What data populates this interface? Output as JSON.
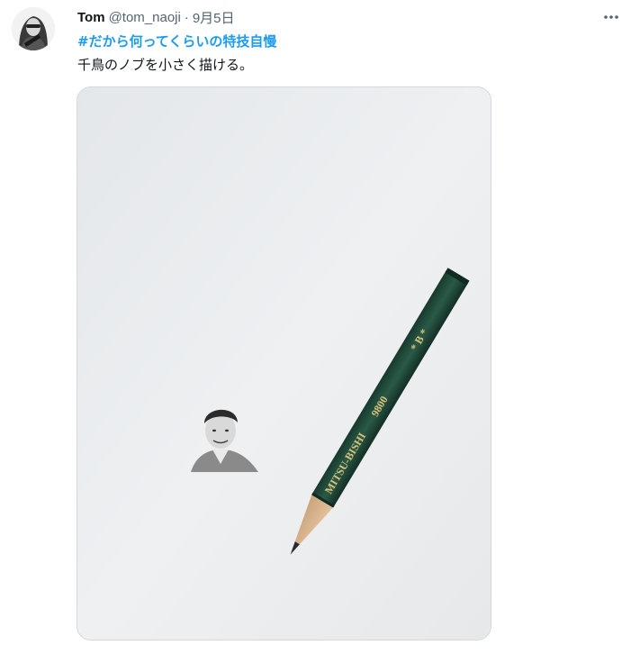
{
  "tweet": {
    "display_name": "Tom",
    "handle": "@tom_naoji",
    "separator": "·",
    "date": "9月5日",
    "hashtag": "#だから何ってくらいの特技自慢",
    "text": "千鳥のノブを小さく描ける。",
    "more_icon": "more-horizontal-icon",
    "avatar_icon": "profile-avatar"
  },
  "media": {
    "pencil_imprint_1": "MITSU-BISHI",
    "pencil_imprint_2": "9800",
    "pencil_grade": "* B *"
  },
  "colors": {
    "link": "#1d9bf0",
    "secondary_text": "#536471",
    "primary_text": "#0f1419",
    "pencil_body": "#1f4a3a",
    "paper": "#eceef0"
  }
}
